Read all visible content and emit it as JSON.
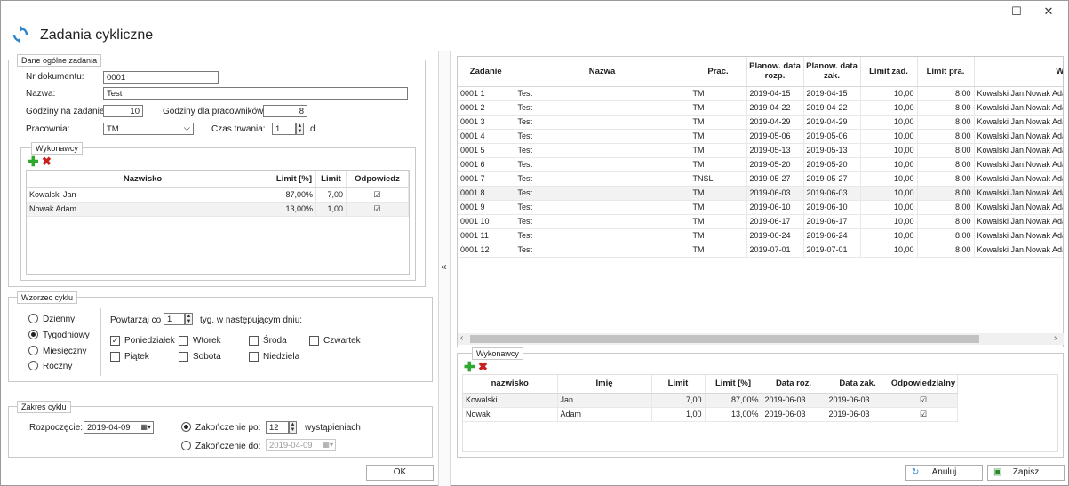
{
  "window": {
    "title": "Zadania cykliczne",
    "minimize": "—",
    "maximize": "☐",
    "close": "✕"
  },
  "general": {
    "legend": "Dane ogólne zadania",
    "doc_no_label": "Nr dokumentu:",
    "doc_no": "0001",
    "name_label": "Nazwa:",
    "name": "Test",
    "hours_task_label": "Godziny na zadanie:",
    "hours_task": "10",
    "hours_workers_label": "Godziny dla pracowników:",
    "hours_workers": "8",
    "workshop_label": "Pracownia:",
    "workshop": "TM",
    "duration_label": "Czas trwania:",
    "duration": "1",
    "duration_unit": "d"
  },
  "workers_left": {
    "legend": "Wykonawcy",
    "columns": [
      "Nazwisko",
      "Limit [%]",
      "Limit",
      "Odpowiedz"
    ],
    "rows": [
      {
        "name": "Kowalski Jan",
        "limit_pct": "87,00%",
        "limit": "7,00",
        "resp": "☑"
      },
      {
        "name": "Nowak Adam",
        "limit_pct": "13,00%",
        "limit": "1,00",
        "resp": "☑"
      }
    ]
  },
  "cycle": {
    "legend": "Wzorzec cyklu",
    "options": [
      "Dzienny",
      "Tygodniowy",
      "Miesięczny",
      "Roczny"
    ],
    "repeat_label": "Powtarzaj co",
    "repeat_value": "1",
    "repeat_suffix": "tyg. w następującym dniu:",
    "days": [
      "Poniedziałek",
      "Wtorek",
      "Środa",
      "Czwartek",
      "Piątek",
      "Sobota",
      "Niedziela"
    ]
  },
  "range": {
    "legend": "Zakres cyklu",
    "start_label": "Rozpoczęcie:",
    "start": "2019-04-09",
    "end_after_label": "Zakończenie po:",
    "end_after": "12",
    "end_after_suffix": "wystąpieniach",
    "end_by_label": "Zakończenie do:",
    "end_by": "2019-04-09"
  },
  "ok_label": "OK",
  "collapse_glyph": "«",
  "tasks": {
    "columns": [
      "Zadanie",
      "Nazwa",
      "Prac.",
      "Planow. data rozp.",
      "Planow. data zak.",
      "Limit zad.",
      "Limit pra.",
      "Wyko"
    ],
    "rows": [
      [
        "0001 1",
        "Test",
        "TM",
        "2019-04-15",
        "2019-04-15",
        "10,00",
        "8,00",
        "Kowalski Jan,Nowak Ada"
      ],
      [
        "0001 2",
        "Test",
        "TM",
        "2019-04-22",
        "2019-04-22",
        "10,00",
        "8,00",
        "Kowalski Jan,Nowak Ada"
      ],
      [
        "0001 3",
        "Test",
        "TM",
        "2019-04-29",
        "2019-04-29",
        "10,00",
        "8,00",
        "Kowalski Jan,Nowak Ada"
      ],
      [
        "0001 4",
        "Test",
        "TM",
        "2019-05-06",
        "2019-05-06",
        "10,00",
        "8,00",
        "Kowalski Jan,Nowak Ada"
      ],
      [
        "0001 5",
        "Test",
        "TM",
        "2019-05-13",
        "2019-05-13",
        "10,00",
        "8,00",
        "Kowalski Jan,Nowak Ada"
      ],
      [
        "0001 6",
        "Test",
        "TM",
        "2019-05-20",
        "2019-05-20",
        "10,00",
        "8,00",
        "Kowalski Jan,Nowak Ada"
      ],
      [
        "0001 7",
        "Test",
        "TNSL",
        "2019-05-27",
        "2019-05-27",
        "10,00",
        "8,00",
        "Kowalski Jan,Nowak Ada"
      ],
      [
        "0001 8",
        "Test",
        "TM",
        "2019-06-03",
        "2019-06-03",
        "10,00",
        "8,00",
        "Kowalski Jan,Nowak Ada"
      ],
      [
        "0001 9",
        "Test",
        "TM",
        "2019-06-10",
        "2019-06-10",
        "10,00",
        "8,00",
        "Kowalski Jan,Nowak Ada"
      ],
      [
        "0001 10",
        "Test",
        "TM",
        "2019-06-17",
        "2019-06-17",
        "10,00",
        "8,00",
        "Kowalski Jan,Nowak Ada"
      ],
      [
        "0001 11",
        "Test",
        "TM",
        "2019-06-24",
        "2019-06-24",
        "10,00",
        "8,00",
        "Kowalski Jan,Nowak Ada"
      ],
      [
        "0001 12",
        "Test",
        "TM",
        "2019-07-01",
        "2019-07-01",
        "10,00",
        "8,00",
        "Kowalski Jan,Nowak Ada"
      ]
    ]
  },
  "workers_right": {
    "legend": "Wykonawcy",
    "columns": [
      "nazwisko",
      "Imię",
      "Limit",
      "Limit [%]",
      "Data roz.",
      "Data zak.",
      "Odpowiedzialny"
    ],
    "rows": [
      [
        "Kowalski",
        "Jan",
        "7,00",
        "87,00%",
        "2019-06-03",
        "2019-06-03",
        "☑"
      ],
      [
        "Nowak",
        "Adam",
        "1,00",
        "13,00%",
        "2019-06-03",
        "2019-06-03",
        "☑"
      ]
    ]
  },
  "buttons": {
    "cancel": "Anuluj",
    "save": "Zapisz"
  }
}
